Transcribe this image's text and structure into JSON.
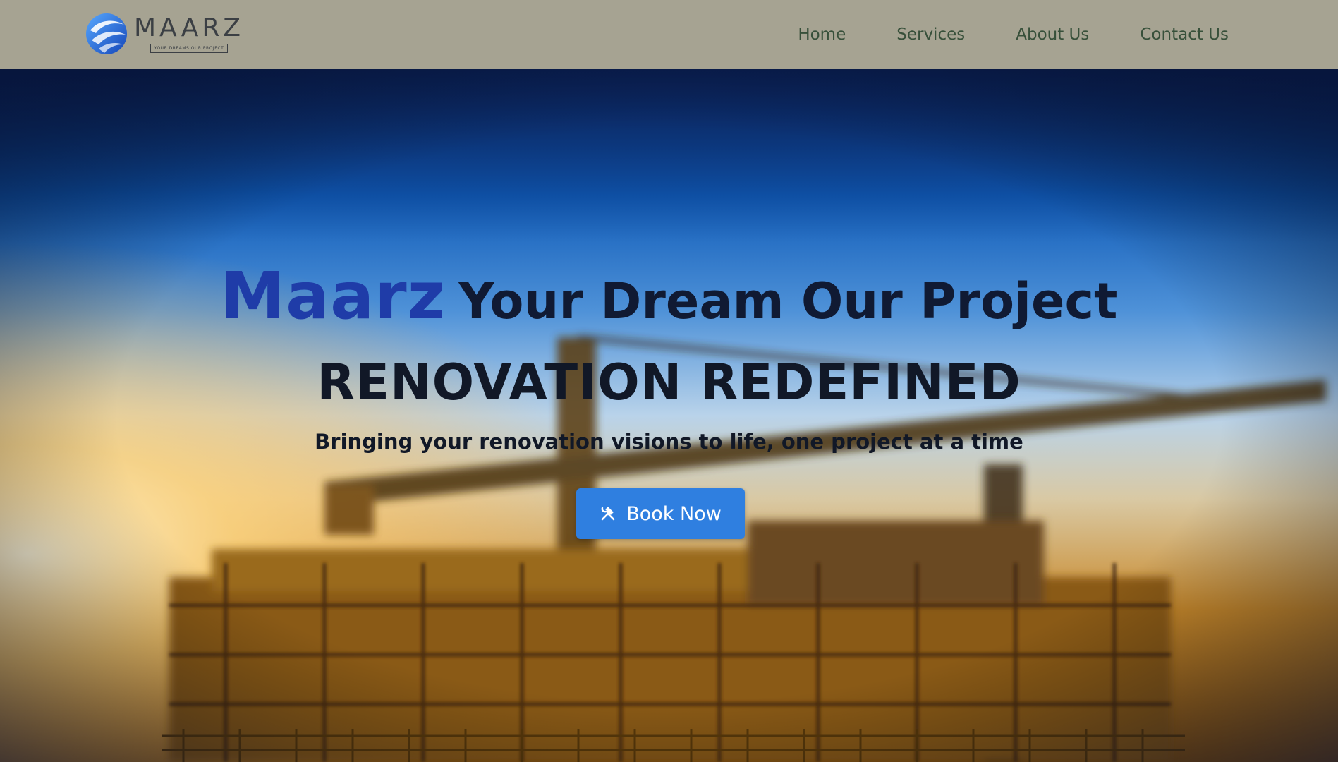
{
  "brand": {
    "name": "MAARZ",
    "tagline": "YOUR DREAMS OUR PROJECT",
    "logo_icon": "swirl-globe-icon",
    "colors": {
      "mark": "#1f6fe0",
      "text": "#3b3f44"
    }
  },
  "nav": {
    "items": [
      {
        "label": "Home"
      },
      {
        "label": "Services"
      },
      {
        "label": "About Us"
      },
      {
        "label": "Contact Us"
      }
    ]
  },
  "hero": {
    "brand_word": "Maarz",
    "title": "Your Dream Our Project",
    "subtitle": "RENOVATION REDEFINED",
    "lead": "Bringing your renovation visions to life, one project at a time",
    "cta": {
      "label": "Book Now",
      "icon": "tools-icon"
    },
    "background": "blurred construction site with crane at sunset",
    "colors": {
      "accent": "#1f3ca8",
      "button": "#2f7fe0",
      "navbar": "#a6a392"
    }
  }
}
